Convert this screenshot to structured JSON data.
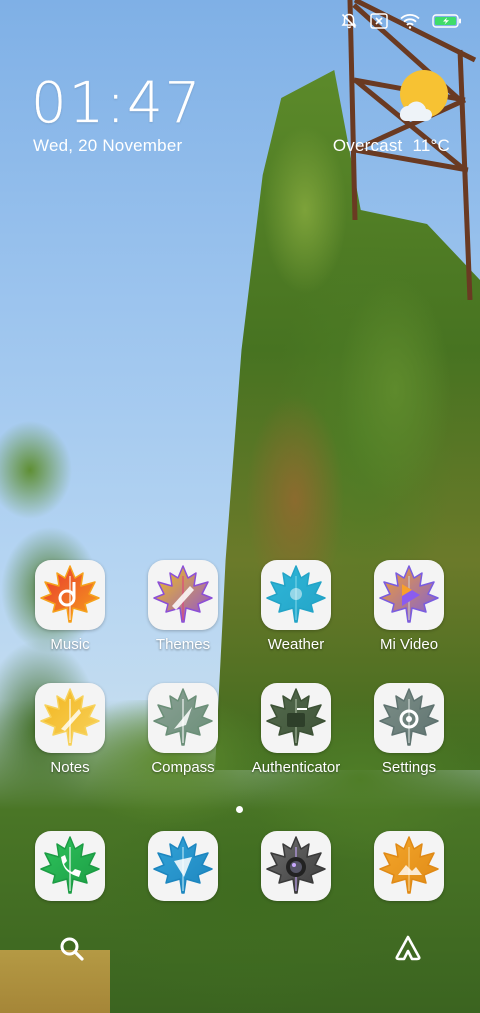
{
  "status_bar": {
    "icons": [
      "alarm-off-icon",
      "sim-card-icon",
      "wifi-icon",
      "battery-charging-icon"
    ]
  },
  "clock": {
    "time": "01:47",
    "date": "Wed, 20 November"
  },
  "weather": {
    "condition": "Overcast",
    "temperature": "11°C",
    "icon": "sun-cloud-icon"
  },
  "apps": [
    {
      "label": "Music",
      "icon": "music-icon",
      "colors": [
        "#e8342f",
        "#f6a21c",
        "#ffffff"
      ]
    },
    {
      "label": "Themes",
      "icon": "themes-icon",
      "colors": [
        "#f2c21b",
        "#8c4fd6",
        "#e23f7c"
      ]
    },
    {
      "label": "Weather",
      "icon": "weather-icon",
      "colors": [
        "#2fb6d8",
        "#23a4c7",
        "#7fd6ea"
      ]
    },
    {
      "label": "Mi Video",
      "icon": "mi-video-icon",
      "colors": [
        "#f7a02b",
        "#7a5ce0",
        "#cfcfcf"
      ]
    },
    {
      "label": "Notes",
      "icon": "notes-icon",
      "colors": [
        "#f3b51f",
        "#f7d25c",
        "#ffffff"
      ]
    },
    {
      "label": "Compass",
      "icon": "compass-icon",
      "colors": [
        "#8aa095",
        "#6b8f78",
        "#ffffff"
      ]
    },
    {
      "label": "Authenticator",
      "icon": "authenticator-icon",
      "colors": [
        "#556b4f",
        "#3d5236",
        "#aebfa5"
      ]
    },
    {
      "label": "Settings",
      "icon": "settings-icon",
      "colors": [
        "#7d8f88",
        "#5f7370",
        "#d8e1dd"
      ]
    }
  ],
  "dock": [
    {
      "icon": "phone-icon",
      "colors": [
        "#2ec35c",
        "#1c9c44",
        "#ffffff"
      ]
    },
    {
      "icon": "messages-icon",
      "colors": [
        "#33a3d8",
        "#1d86bf",
        "#c4ecf8"
      ]
    },
    {
      "icon": "camera-icon",
      "colors": [
        "#6e6e6e",
        "#3a3a3a",
        "#c8a8ff"
      ]
    },
    {
      "icon": "gallery-icon",
      "colors": [
        "#f3a62b",
        "#e08a16",
        "#f7d79a"
      ]
    }
  ],
  "bottom_bar": {
    "left_icon": "search-icon",
    "right_icon": "assistant-icon"
  }
}
